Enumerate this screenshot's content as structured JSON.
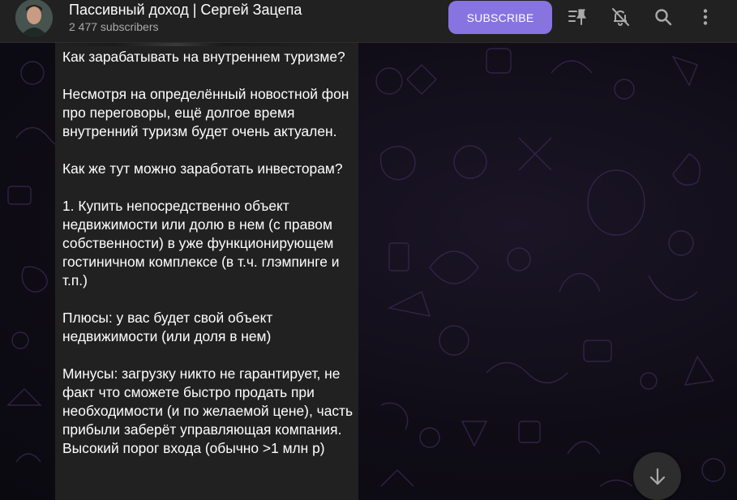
{
  "header": {
    "channel_title": "Пассивный доход | Сергей Зацепа",
    "subscribers": "2 477 subscribers",
    "subscribe_label": "SUBSCRIBE",
    "icons": [
      "pinned-messages-icon",
      "mute-icon",
      "search-icon",
      "more-icon"
    ]
  },
  "message": {
    "text": "Как зарабатывать на внутреннем туризме?\n\nНесмотря на определённый новостной фон про переговоры, ещё долгое время внутренний туризм будет очень актуален.\n\nКак же тут можно заработать инвесторам?\n\n1. Купить непосредственно объект недвижимости или долю в нем (с правом собственности) в уже функционирующем гостиничном комплексе (в т.ч. глэмпинге и т.п.)\n\nПлюсы: у вас будет свой объект недвижимости (или доля в нем)\n\nМинусы: загрузку никто не гарантирует, не факт что сможете быстро продать при необходимости (и по желаемой цене), часть прибыли заберёт управляющая компания. Высокий порог входа (обычно >1 млн р)"
  },
  "colors": {
    "accent": "#8774e1",
    "header_bg": "#212121",
    "bubble_bg": "#212121",
    "muted_text": "#aaaaaa"
  }
}
